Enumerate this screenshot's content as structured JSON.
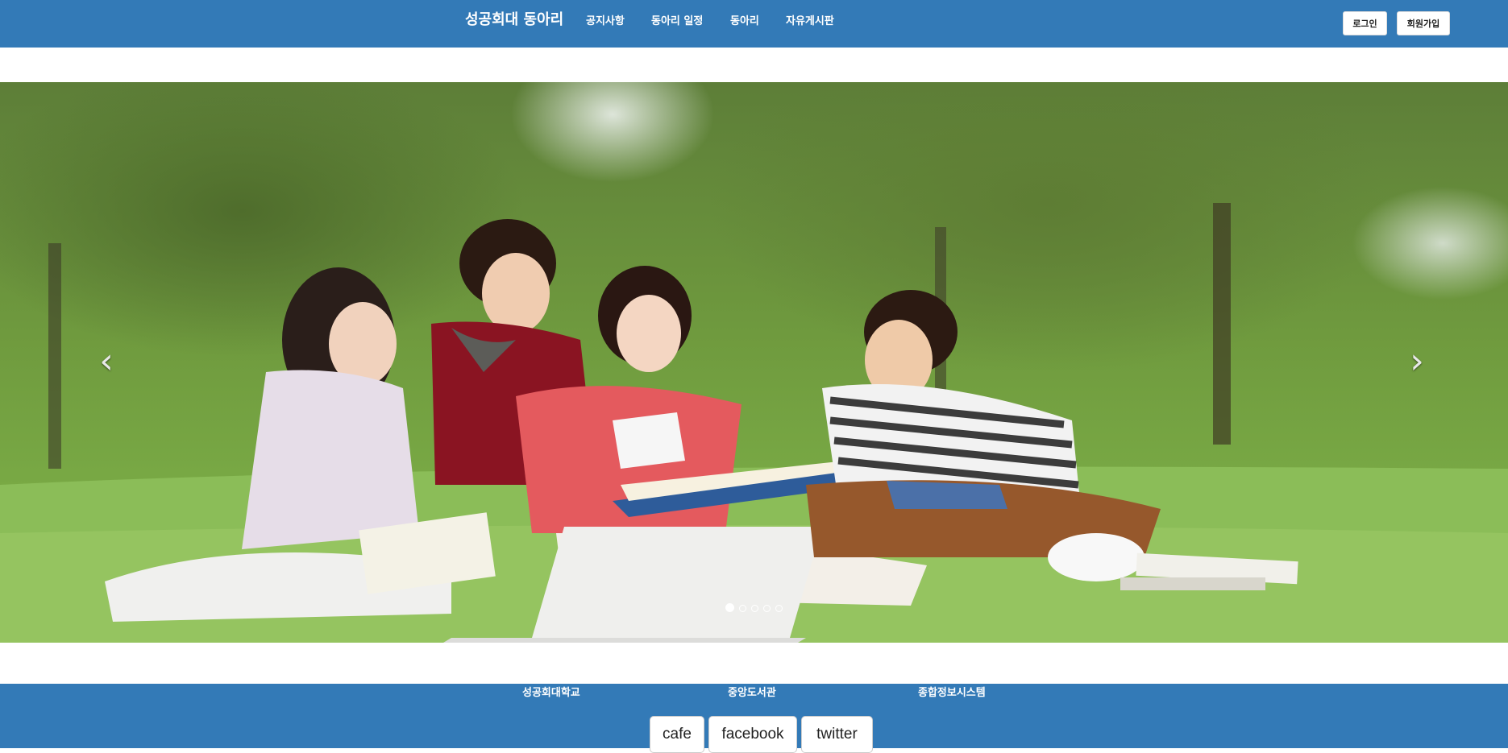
{
  "navbar": {
    "brand": "성공회대 동아리",
    "items": [
      {
        "label": "공지사항"
      },
      {
        "label": "동아리 일정"
      },
      {
        "label": "동아리"
      },
      {
        "label": "자유게시판"
      }
    ],
    "login_label": "로그인",
    "signup_label": "회원가입",
    "background": "#337ab7"
  },
  "carousel": {
    "prev_icon": "chevron-left-icon",
    "next_icon": "chevron-right-icon",
    "prev_glyph": "‹",
    "next_glyph": "›",
    "slide_count": 5,
    "active_slide": 1
  },
  "footer": {
    "links": [
      {
        "label": "성공회대학교"
      },
      {
        "label": "중앙도서관"
      },
      {
        "label": "종합정보시스템"
      }
    ],
    "social": [
      {
        "label": "cafe"
      },
      {
        "label": "facebook"
      },
      {
        "label": "twitter"
      }
    ],
    "background": "#337ab7"
  }
}
